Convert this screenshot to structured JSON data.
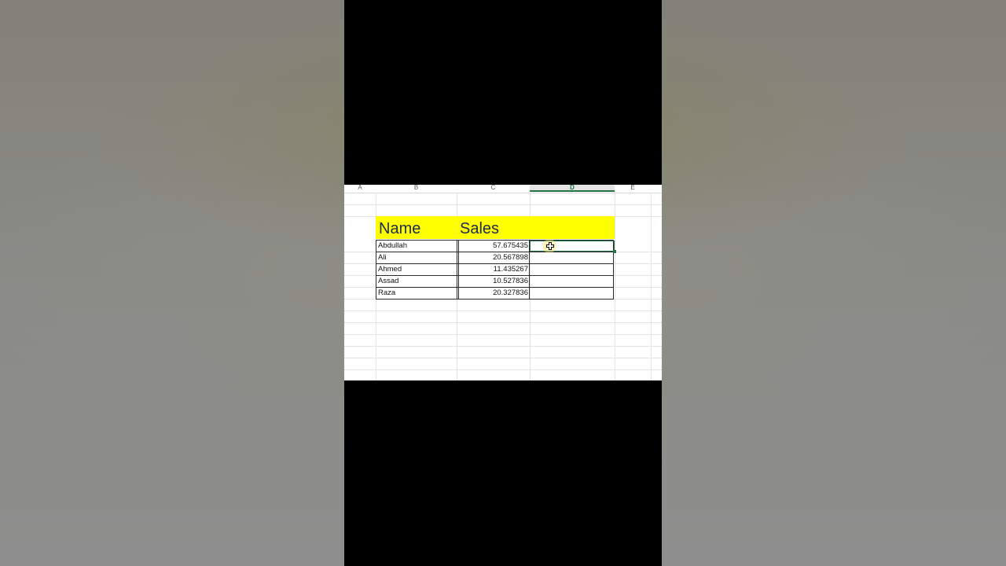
{
  "spreadsheet": {
    "columns": [
      "A",
      "B",
      "C",
      "D",
      "E"
    ],
    "header": {
      "name": "Name",
      "sales": "Sales"
    },
    "rows": [
      {
        "name": "Abdullah",
        "sales": "57.675435"
      },
      {
        "name": "Ali",
        "sales": "20.567898"
      },
      {
        "name": "Ahmed",
        "sales": "11.435267"
      },
      {
        "name": "Assad",
        "sales": "10.527836"
      },
      {
        "name": "Raza",
        "sales": "20.327836"
      }
    ],
    "selected_cell": "D",
    "header_fill_color": "#ffff00",
    "selection_color": "#217346"
  },
  "cursor": {
    "icon": "cell-select-plus-icon"
  }
}
